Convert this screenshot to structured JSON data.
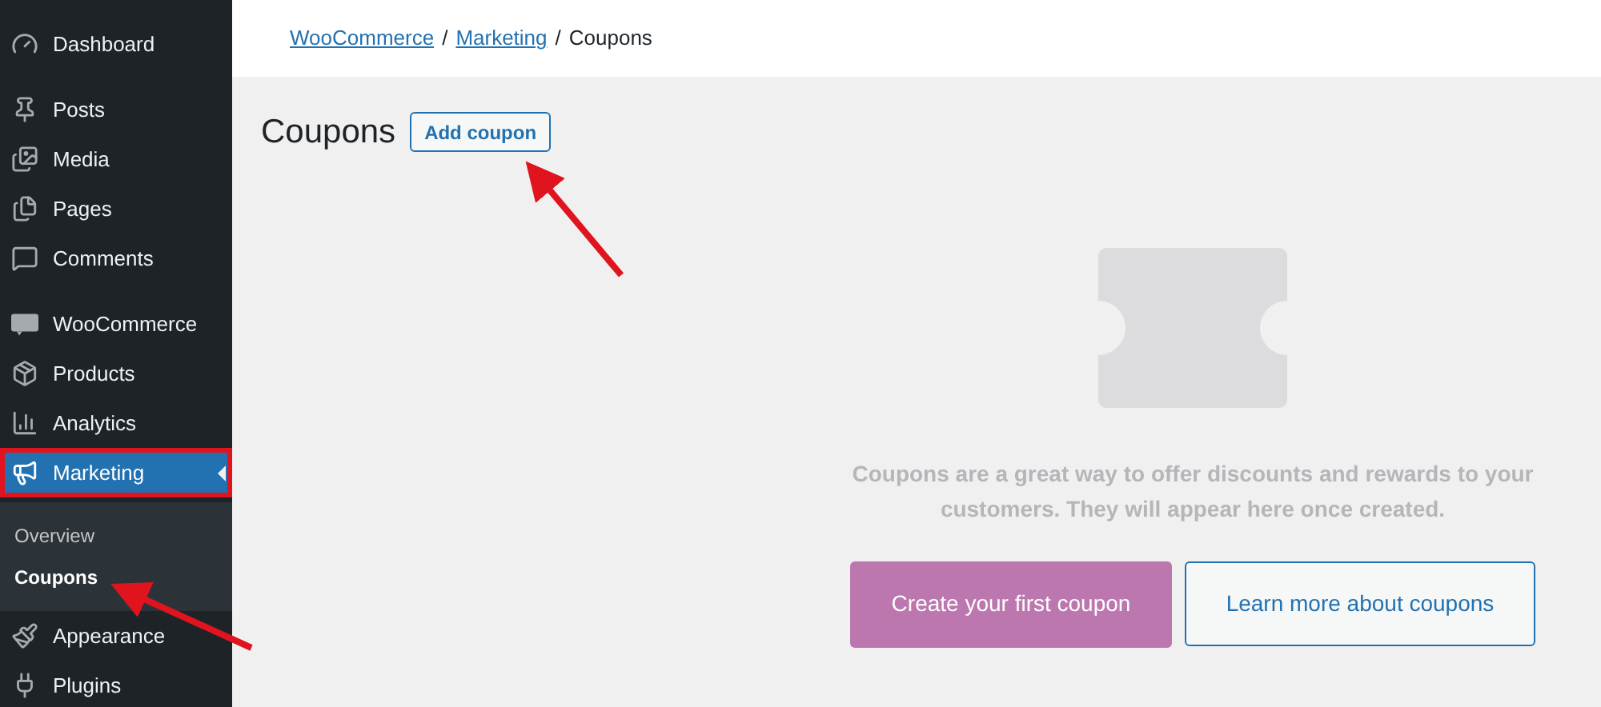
{
  "sidebar": {
    "groups": [
      [
        {
          "label": "Dashboard",
          "selected": false,
          "outlined": false
        }
      ],
      [
        {
          "label": "Posts",
          "selected": false,
          "outlined": false
        },
        {
          "label": "Media",
          "selected": false,
          "outlined": false
        },
        {
          "label": "Pages",
          "selected": false,
          "outlined": false
        },
        {
          "label": "Comments",
          "selected": false,
          "outlined": false
        }
      ],
      [
        {
          "label": "WooCommerce",
          "selected": false,
          "outlined": false
        },
        {
          "label": "Products",
          "selected": false,
          "outlined": false
        },
        {
          "label": "Analytics",
          "selected": false,
          "outlined": false
        },
        {
          "label": "Marketing",
          "selected": true,
          "outlined": true,
          "children": [
            {
              "label": "Overview",
              "selected": false
            },
            {
              "label": "Coupons",
              "selected": true
            }
          ]
        }
      ],
      [
        {
          "label": "Appearance",
          "selected": false,
          "outlined": false
        },
        {
          "label": "Plugins",
          "selected": false,
          "outlined": false
        }
      ]
    ]
  },
  "breadcrumb": [
    {
      "label": "WooCommerce",
      "kind": "link"
    },
    {
      "label": "/",
      "kind": "separator"
    },
    {
      "label": "Marketing",
      "kind": "link"
    },
    {
      "label": "/",
      "kind": "separator"
    },
    {
      "label": "Coupons",
      "kind": "current"
    }
  ],
  "page": {
    "title": "Coupons",
    "add_button": "Add coupon"
  },
  "empty_state": {
    "message": "Coupons are a great way to offer discounts and rewards to your customers. They will appear here once created.",
    "primary_button": "Create your first coupon",
    "secondary_button": "Learn more about coupons"
  }
}
